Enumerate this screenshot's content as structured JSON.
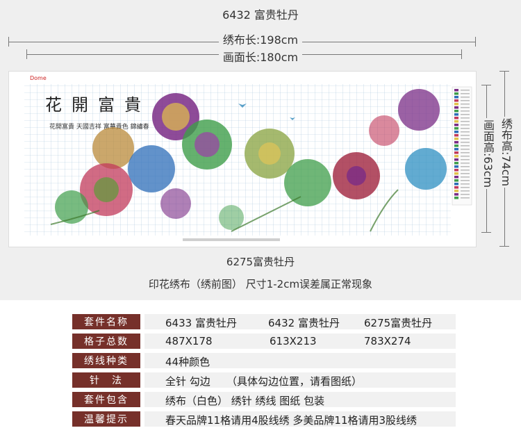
{
  "header": {
    "title": "6432 富贵牡丹",
    "cloth_length": "绣布长:198cm",
    "image_length": "画面长:180cm",
    "cloth_height": "绣布高:74cm",
    "image_height": "画面高:63cm"
  },
  "artwork": {
    "brand": "Dome",
    "calligraphy_title": "花開富貴",
    "calligraphy_poem": "花開富貴 天國吉祥 富華貴色 錦繡春",
    "grid_color": "#a9c7de",
    "accent_colors": [
      "#7a2c86",
      "#3f9e4a",
      "#2d6db8",
      "#c23a5b",
      "#e2c14a"
    ]
  },
  "captions": {
    "model": "6275富贵牡丹",
    "note": "印花绣布（绣前图） 尺寸1-2cm误差属正常现象"
  },
  "specs": [
    {
      "label": "套件名称",
      "cells": [
        "6433 富贵牡丹",
        "6432 富贵牡丹",
        "6275富贵牡丹"
      ]
    },
    {
      "label": "格子总数",
      "cells": [
        "487X178",
        "613X213",
        "783X274"
      ]
    },
    {
      "label": "绣线种类",
      "cells": [
        "44种颜色"
      ]
    },
    {
      "label": "针　法",
      "cells": [
        "全针 勾边",
        "（具体勾边位置，请看图纸）"
      ]
    },
    {
      "label": "套件包含",
      "cells": [
        "绣布（白色） 绣针 绣线 图纸 包装"
      ]
    },
    {
      "label": "温馨提示",
      "cells": [
        "春天品牌11格请用4股线绣 多美品牌11格请用3股线绣"
      ]
    }
  ],
  "colors": {
    "label_bg": "#76302a",
    "note_red": "#e11111"
  }
}
